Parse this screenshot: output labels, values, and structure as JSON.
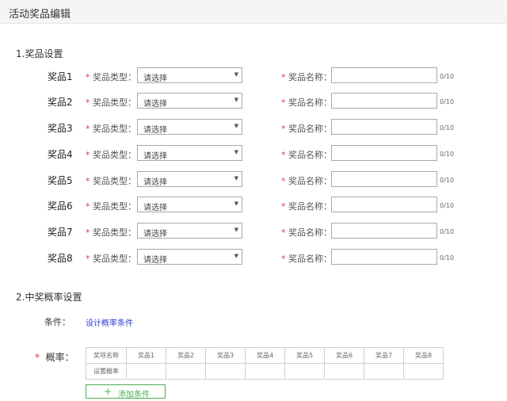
{
  "header": {
    "title": "活动奖品编辑"
  },
  "section1": {
    "title": "1.奖品设置"
  },
  "prize_form": {
    "required_mark": "*",
    "type_label": "奖品类型：",
    "type_placeholder": "请选择",
    "name_label": "奖品名称：",
    "char_count": "0/10",
    "prizes": [
      {
        "label": "奖品1",
        "name_value": ""
      },
      {
        "label": "奖品2",
        "name_value": ""
      },
      {
        "label": "奖品3",
        "name_value": ""
      },
      {
        "label": "奖品4",
        "name_value": ""
      },
      {
        "label": "奖品5",
        "name_value": ""
      },
      {
        "label": "奖品6",
        "name_value": ""
      },
      {
        "label": "奖品7",
        "name_value": ""
      },
      {
        "label": "奖品8",
        "name_value": ""
      }
    ]
  },
  "section2": {
    "title": "2.中奖概率设置",
    "condition_label": "条件：",
    "condition_link": "设计概率条件",
    "probability_label": "概率：",
    "required_mark": "*",
    "table": {
      "header": [
        "奖项名称",
        "奖品1",
        "奖品2",
        "奖品3",
        "奖品4",
        "奖品5",
        "奖品6",
        "奖品7",
        "奖品8"
      ],
      "row": [
        "设置概率",
        "",
        "",
        "",
        "",
        "",
        "",
        "",
        ""
      ]
    },
    "add_button": "添加条件"
  },
  "colors": {
    "required": "#e4393c",
    "link": "#2a3fd6",
    "add_button": "#4caf50"
  }
}
